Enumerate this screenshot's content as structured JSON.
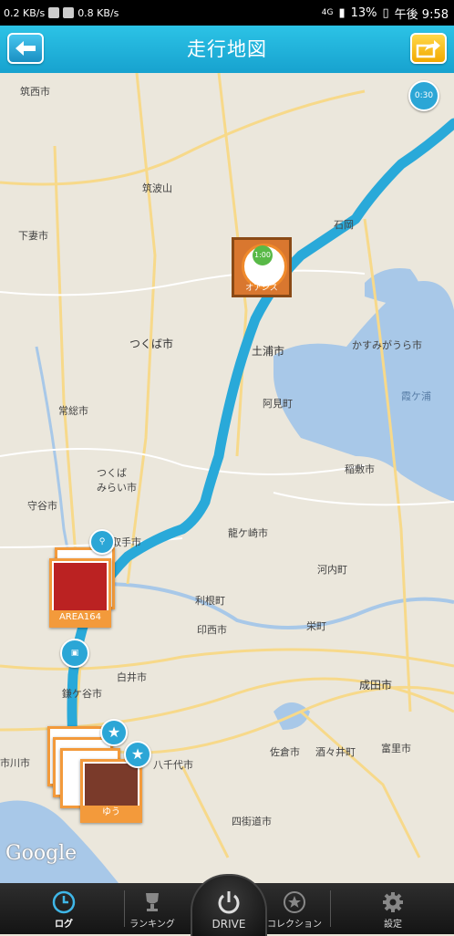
{
  "status_bar": {
    "left_text_1": "0.2 KB/s",
    "left_text_2": "0.8 KB/s",
    "battery": "13%",
    "time": "午後 9:58",
    "network": "4G"
  },
  "header": {
    "title": "走行地図",
    "back_icon": "back-arrow-icon",
    "share_icon": "share-icon"
  },
  "map": {
    "labels": {
      "chikusei": "筑西市",
      "tsukubasan": "筑波山",
      "shimotsuma": "下妻市",
      "tsukuba": "つくば市",
      "tsuchiura": "土浦市",
      "kasumigaura_city": "かすみがうら市",
      "kasumigaura_lake": "霞ケ浦",
      "ami": "阿見町",
      "jouso": "常総市",
      "tsukubamirai": "つくば\nみらい市",
      "moriya": "守谷市",
      "ryugasaki": "龍ケ崎市",
      "toride": "取手市",
      "tone": "利根町",
      "inzai": "印西市",
      "shiroi": "白井市",
      "kamagaya": "鎌ケ谷市",
      "yachiyo": "八千代市",
      "sakura": "佐倉市",
      "narita": "成田市",
      "shisui": "酒々井町",
      "tomisato": "富里市",
      "yotsukaido": "四街道市",
      "ichikawa": "市川市",
      "ishioka": "石岡",
      "inashiki": "稲敷市",
      "kawachi": "河内町",
      "sakae": "栄町",
      "google": "Google",
      "area_label": "AREA164",
      "yu_label": "ゆう",
      "pin_top": "0:30",
      "pin_oasis": "オアシス",
      "pin_oasis_time": "1:00"
    }
  },
  "tabbar": {
    "tabs": [
      {
        "label": "ログ",
        "icon": "clock-icon"
      },
      {
        "label": "ランキング",
        "icon": "trophy-icon"
      },
      {
        "label": "DRIVE",
        "icon": "power-icon"
      },
      {
        "label": "コレクション",
        "icon": "star-icon"
      },
      {
        "label": "設定",
        "icon": "gear-icon"
      }
    ]
  },
  "colors": {
    "header": "#1fb3dc",
    "route": "#29a9d9",
    "water": "#a8c8e8",
    "accent_orange": "#f39a3b"
  }
}
